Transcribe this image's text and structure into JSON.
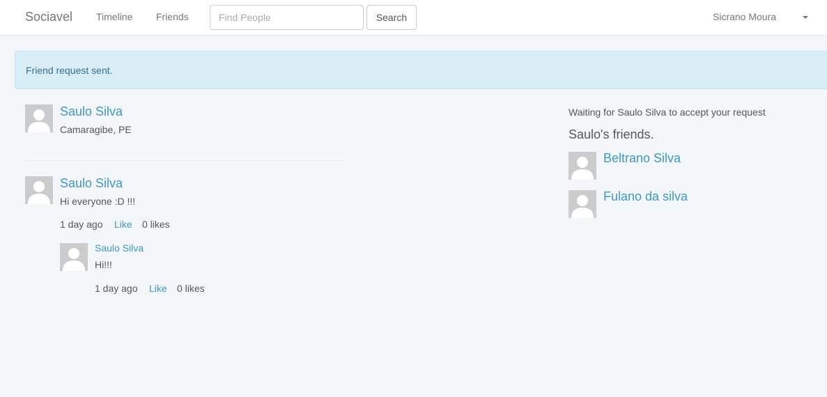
{
  "navbar": {
    "brand": "Sociavel",
    "links": [
      "Timeline",
      "Friends"
    ],
    "search": {
      "placeholder": "Find People",
      "value": "",
      "button": "Search"
    },
    "user": "Sicrano Moura"
  },
  "alert": {
    "message": "Friend request sent."
  },
  "profile": {
    "name": "Saulo Silva",
    "location": "Camaragibe, PE"
  },
  "status": {
    "author": "Saulo Silva",
    "body": "Hi everyone :D !!!",
    "time": "1 day ago",
    "like_label": "Like",
    "likes": "0 likes",
    "reply": {
      "author": "Saulo Silva",
      "body": "Hi!!!",
      "time": "1 day ago",
      "like_label": "Like",
      "likes": "0 likes"
    }
  },
  "sidebar": {
    "waiting_text": "Waiting for Saulo Silva to accept your request",
    "friends_heading": "Saulo's friends.",
    "friends": [
      "Beltrano Silva",
      "Fulano da silva"
    ]
  },
  "colors": {
    "link": "#3d97c7",
    "alert_bg": "#d9edf7",
    "alert_text": "#31708f",
    "page_bg": "#f3f7fa"
  },
  "icons": {
    "avatar": "default-user-icon"
  }
}
